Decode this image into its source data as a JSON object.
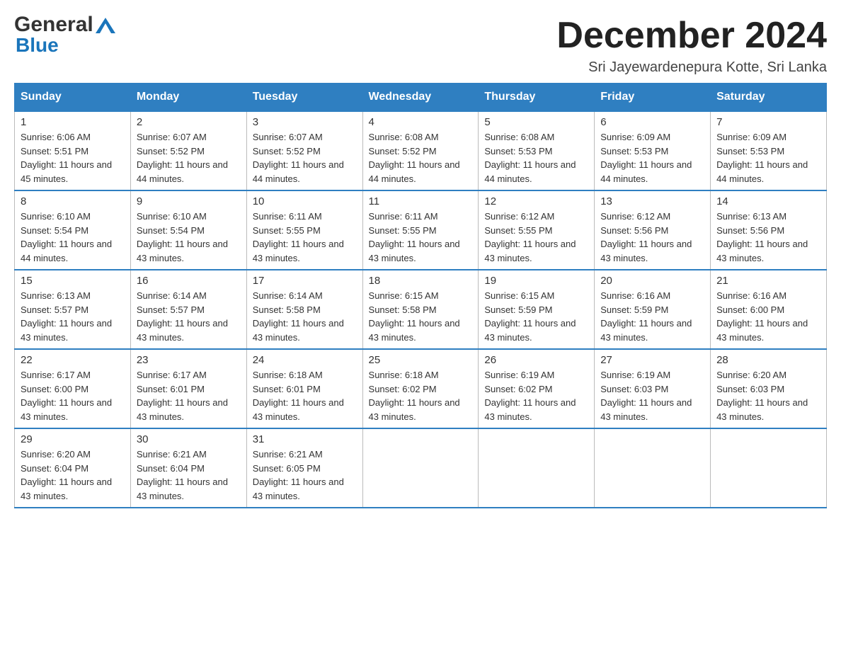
{
  "header": {
    "logo_general": "General",
    "logo_blue": "Blue",
    "month_title": "December 2024",
    "location": "Sri Jayewardenepura Kotte, Sri Lanka"
  },
  "calendar": {
    "days": [
      "Sunday",
      "Monday",
      "Tuesday",
      "Wednesday",
      "Thursday",
      "Friday",
      "Saturday"
    ],
    "weeks": [
      [
        {
          "num": "1",
          "sunrise": "6:06 AM",
          "sunset": "5:51 PM",
          "daylight": "11 hours and 45 minutes."
        },
        {
          "num": "2",
          "sunrise": "6:07 AM",
          "sunset": "5:52 PM",
          "daylight": "11 hours and 44 minutes."
        },
        {
          "num": "3",
          "sunrise": "6:07 AM",
          "sunset": "5:52 PM",
          "daylight": "11 hours and 44 minutes."
        },
        {
          "num": "4",
          "sunrise": "6:08 AM",
          "sunset": "5:52 PM",
          "daylight": "11 hours and 44 minutes."
        },
        {
          "num": "5",
          "sunrise": "6:08 AM",
          "sunset": "5:53 PM",
          "daylight": "11 hours and 44 minutes."
        },
        {
          "num": "6",
          "sunrise": "6:09 AM",
          "sunset": "5:53 PM",
          "daylight": "11 hours and 44 minutes."
        },
        {
          "num": "7",
          "sunrise": "6:09 AM",
          "sunset": "5:53 PM",
          "daylight": "11 hours and 44 minutes."
        }
      ],
      [
        {
          "num": "8",
          "sunrise": "6:10 AM",
          "sunset": "5:54 PM",
          "daylight": "11 hours and 44 minutes."
        },
        {
          "num": "9",
          "sunrise": "6:10 AM",
          "sunset": "5:54 PM",
          "daylight": "11 hours and 43 minutes."
        },
        {
          "num": "10",
          "sunrise": "6:11 AM",
          "sunset": "5:55 PM",
          "daylight": "11 hours and 43 minutes."
        },
        {
          "num": "11",
          "sunrise": "6:11 AM",
          "sunset": "5:55 PM",
          "daylight": "11 hours and 43 minutes."
        },
        {
          "num": "12",
          "sunrise": "6:12 AM",
          "sunset": "5:55 PM",
          "daylight": "11 hours and 43 minutes."
        },
        {
          "num": "13",
          "sunrise": "6:12 AM",
          "sunset": "5:56 PM",
          "daylight": "11 hours and 43 minutes."
        },
        {
          "num": "14",
          "sunrise": "6:13 AM",
          "sunset": "5:56 PM",
          "daylight": "11 hours and 43 minutes."
        }
      ],
      [
        {
          "num": "15",
          "sunrise": "6:13 AM",
          "sunset": "5:57 PM",
          "daylight": "11 hours and 43 minutes."
        },
        {
          "num": "16",
          "sunrise": "6:14 AM",
          "sunset": "5:57 PM",
          "daylight": "11 hours and 43 minutes."
        },
        {
          "num": "17",
          "sunrise": "6:14 AM",
          "sunset": "5:58 PM",
          "daylight": "11 hours and 43 minutes."
        },
        {
          "num": "18",
          "sunrise": "6:15 AM",
          "sunset": "5:58 PM",
          "daylight": "11 hours and 43 minutes."
        },
        {
          "num": "19",
          "sunrise": "6:15 AM",
          "sunset": "5:59 PM",
          "daylight": "11 hours and 43 minutes."
        },
        {
          "num": "20",
          "sunrise": "6:16 AM",
          "sunset": "5:59 PM",
          "daylight": "11 hours and 43 minutes."
        },
        {
          "num": "21",
          "sunrise": "6:16 AM",
          "sunset": "6:00 PM",
          "daylight": "11 hours and 43 minutes."
        }
      ],
      [
        {
          "num": "22",
          "sunrise": "6:17 AM",
          "sunset": "6:00 PM",
          "daylight": "11 hours and 43 minutes."
        },
        {
          "num": "23",
          "sunrise": "6:17 AM",
          "sunset": "6:01 PM",
          "daylight": "11 hours and 43 minutes."
        },
        {
          "num": "24",
          "sunrise": "6:18 AM",
          "sunset": "6:01 PM",
          "daylight": "11 hours and 43 minutes."
        },
        {
          "num": "25",
          "sunrise": "6:18 AM",
          "sunset": "6:02 PM",
          "daylight": "11 hours and 43 minutes."
        },
        {
          "num": "26",
          "sunrise": "6:19 AM",
          "sunset": "6:02 PM",
          "daylight": "11 hours and 43 minutes."
        },
        {
          "num": "27",
          "sunrise": "6:19 AM",
          "sunset": "6:03 PM",
          "daylight": "11 hours and 43 minutes."
        },
        {
          "num": "28",
          "sunrise": "6:20 AM",
          "sunset": "6:03 PM",
          "daylight": "11 hours and 43 minutes."
        }
      ],
      [
        {
          "num": "29",
          "sunrise": "6:20 AM",
          "sunset": "6:04 PM",
          "daylight": "11 hours and 43 minutes."
        },
        {
          "num": "30",
          "sunrise": "6:21 AM",
          "sunset": "6:04 PM",
          "daylight": "11 hours and 43 minutes."
        },
        {
          "num": "31",
          "sunrise": "6:21 AM",
          "sunset": "6:05 PM",
          "daylight": "11 hours and 43 minutes."
        },
        null,
        null,
        null,
        null
      ]
    ]
  }
}
